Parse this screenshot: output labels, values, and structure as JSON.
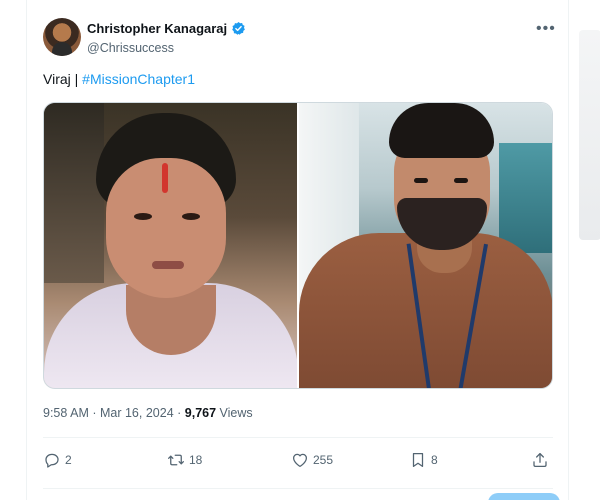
{
  "author": {
    "display_name": "Christopher Kanagaraj",
    "handle": "@Chrissuccess",
    "verified": true
  },
  "tweet": {
    "text_prefix": "Viraj | ",
    "hashtag": "#MissionChapter1"
  },
  "meta": {
    "time": "9:58 AM",
    "separator": " · ",
    "date": "Mar 16, 2024",
    "views_count": "9,767",
    "views_label": " Views"
  },
  "actions": {
    "replies": "2",
    "retweets": "18",
    "likes": "255",
    "bookmarks": "8"
  },
  "icons": {
    "more": "more-icon",
    "verified": "verified-badge-icon",
    "reply": "reply-icon",
    "retweet": "retweet-icon",
    "like": "heart-icon",
    "bookmark": "bookmark-icon",
    "share": "share-icon"
  },
  "colors": {
    "accent": "#1d9bf0",
    "text": "#0f1419",
    "muted": "#536471"
  }
}
